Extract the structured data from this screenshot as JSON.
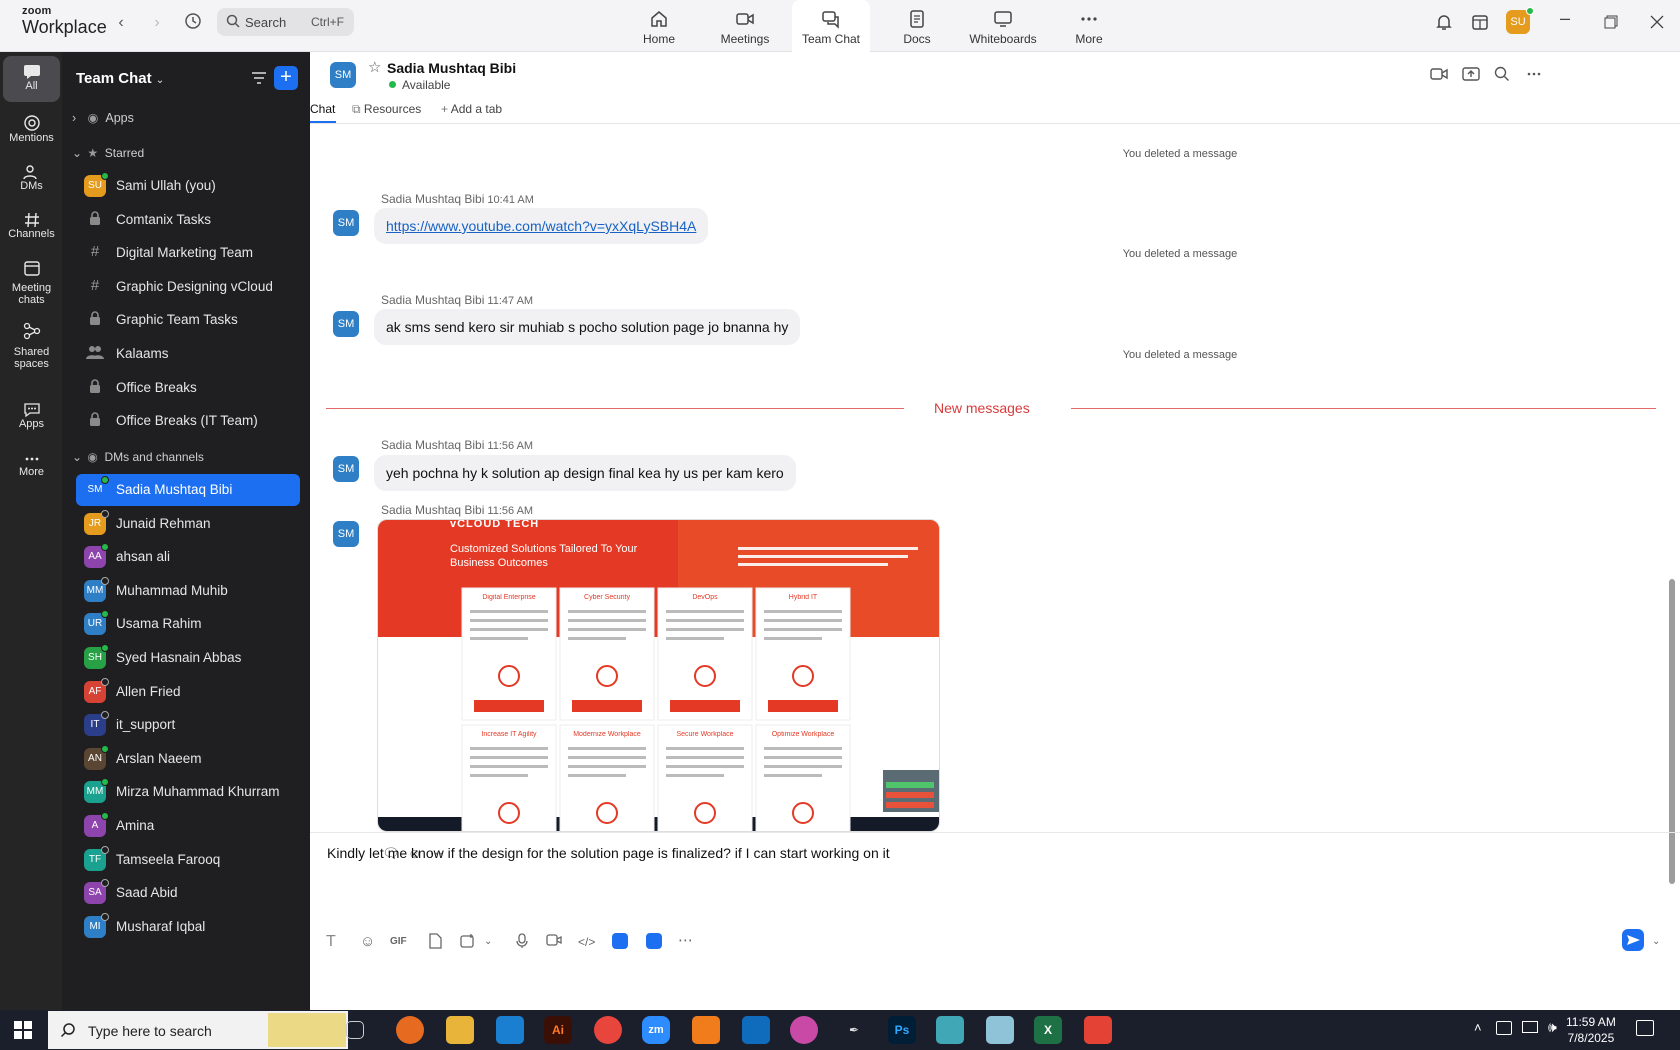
{
  "app": {
    "brand_top": "zoom",
    "brand_bottom": "Workplace"
  },
  "search": {
    "placeholder": "Search",
    "shortcut": "Ctrl+F"
  },
  "nav_tabs": [
    {
      "label": "Home",
      "icon": "home-icon"
    },
    {
      "label": "Meetings",
      "icon": "video-icon"
    },
    {
      "label": "Team Chat",
      "icon": "chat-icon",
      "active": true
    },
    {
      "label": "Docs",
      "icon": "docs-icon"
    },
    {
      "label": "Whiteboards",
      "icon": "whiteboard-icon"
    },
    {
      "label": "More",
      "icon": "more-icon"
    }
  ],
  "user_avatar": "SU",
  "rail": [
    {
      "label": "All",
      "icon": "chat-bubble-icon",
      "active": true
    },
    {
      "label": "Mentions",
      "icon": "at-icon"
    },
    {
      "label": "DMs",
      "icon": "people-icon"
    },
    {
      "label": "Channels",
      "icon": "hash-icon"
    },
    {
      "label": "Meeting chats",
      "label2": "chats",
      "label1": "Meeting",
      "icon": "calendar-icon"
    },
    {
      "label": "Shared spaces",
      "label1": "Shared",
      "label2": "spaces",
      "icon": "shared-icon"
    },
    {
      "label": "Apps",
      "icon": "apps-icon"
    },
    {
      "label": "More",
      "icon": "more-icon"
    }
  ],
  "sidebar": {
    "title": "Team Chat",
    "sections": {
      "apps": "Apps",
      "starred": "Starred",
      "dms": "DMs and channels"
    },
    "starred": [
      {
        "label": "Sami Ullah (you)",
        "avatar": "SU",
        "color": "#e59b1d",
        "status": "on"
      },
      {
        "label": "Comtanix Tasks",
        "icon": "lock"
      },
      {
        "label": "Digital Marketing Team",
        "icon": "hash"
      },
      {
        "label": "Graphic Designing vCloud",
        "icon": "hash"
      },
      {
        "label": "Graphic Team Tasks",
        "icon": "lock"
      },
      {
        "label": "Kalaams",
        "icon": "group"
      },
      {
        "label": "Office Breaks",
        "icon": "lock"
      },
      {
        "label": "Office Breaks (IT Team)",
        "icon": "lock"
      }
    ],
    "dms": [
      {
        "label": "Sadia Mushtaq Bibi",
        "avatar": "SM",
        "color": "#1d6ff2",
        "status": "on",
        "selected": true
      },
      {
        "label": "Junaid Rehman",
        "avatar": "JR",
        "color": "#e59b1d",
        "status": "off"
      },
      {
        "label": "ahsan ali",
        "avatar": "AA",
        "color": "#8e44ad",
        "status": "on"
      },
      {
        "label": "Muhammad Muhib",
        "avatar": "MM",
        "color": "#2e7fc6",
        "status": "off"
      },
      {
        "label": "Usama Rahim",
        "avatar": "UR",
        "color": "#2e7fc6",
        "status": "on"
      },
      {
        "label": "Syed Hasnain Abbas",
        "avatar": "SH",
        "color": "#27a046",
        "status": "on"
      },
      {
        "label": "Allen Fried",
        "avatar": "AF",
        "color": "#d64334",
        "status": "off"
      },
      {
        "label": "it_support",
        "avatar": "IT",
        "color": "#2b3e8a",
        "status": "off"
      },
      {
        "label": "Arslan Naeem",
        "avatar": "AN",
        "color": "#5a4632",
        "status": "on"
      },
      {
        "label": "Mirza Muhammad Khurram",
        "avatar": "MM",
        "color": "#1aa18f",
        "status": "on"
      },
      {
        "label": "Amina",
        "avatar": "A",
        "color": "#8e44ad",
        "status": "on"
      },
      {
        "label": "Tamseela Farooq",
        "avatar": "TF",
        "color": "#1aa18f",
        "status": "off"
      },
      {
        "label": "Saad Abid",
        "avatar": "SA",
        "color": "#8e44ad",
        "status": "off"
      },
      {
        "label": "Musharaf Iqbal",
        "avatar": "MI",
        "color": "#2e7fc6",
        "status": "off"
      }
    ]
  },
  "chat": {
    "contact_name": "Sadia Mushtaq Bibi",
    "contact_avatar": "SM",
    "status": "Available",
    "tabs": [
      "Chat",
      "Resources",
      "Add a tab"
    ],
    "deleted_text": "You deleted a message",
    "new_messages": "New messages",
    "messages": [
      {
        "sender": "Sadia Mushtaq Bibi",
        "time": "10:41 AM",
        "text": "https://www.youtube.com/watch?v=yxXqLySBH4A",
        "is_link": true
      },
      {
        "sender": "Sadia Mushtaq Bibi",
        "time": "11:47 AM",
        "text": "ak sms send kero sir muhiab s pocho solution page jo bnanna hy"
      },
      {
        "sender": "Sadia Mushtaq Bibi",
        "time": "11:56 AM",
        "text": "yeh pochna hy k solution ap design final kea hy us per kam kero"
      },
      {
        "sender": "Sadia Mushtaq Bibi",
        "time": "11:56 AM",
        "image": true
      }
    ],
    "screenshot": {
      "brand": "vCLOUD TECH",
      "heading": "Customized Solutions Tailored To Your Business Outcomes",
      "cards": [
        "Digital Enterprise",
        "Cyber Security",
        "DevOps",
        "Hybrid IT",
        "Increase IT Agility",
        "Modernize Workplace",
        "Secure Workplace",
        "Optimize Workplace"
      ]
    },
    "compose_text": "Kindly let me know if the design for the solution page is finalized?  if I can start working on it"
  },
  "taskbar": {
    "search_placeholder": "Type here to search",
    "time": "11:59 AM",
    "date": "7/8/2025"
  },
  "colors": {
    "accent": "#1d6ff2",
    "new_messages": "#d83b3b",
    "sidebar": "#1f1f21",
    "rail": "#252526"
  }
}
